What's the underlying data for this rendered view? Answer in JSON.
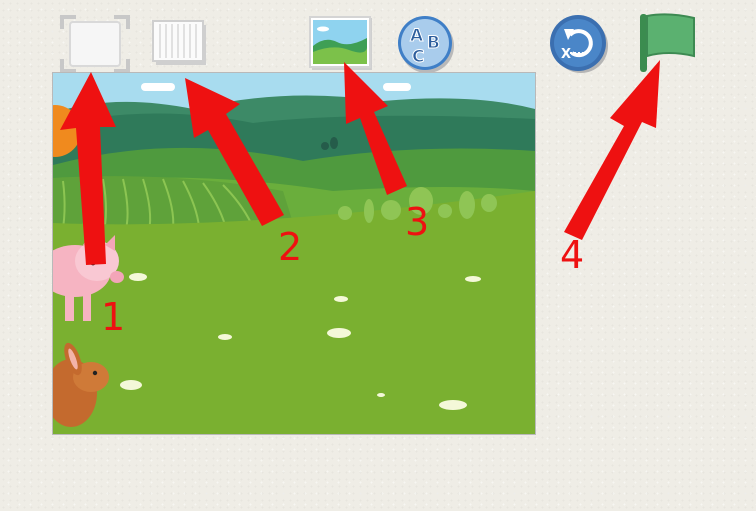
{
  "toolbar": {
    "tools": [
      {
        "name": "fullscreen",
        "icon": "fullscreen-icon"
      },
      {
        "name": "grid",
        "icon": "grid-icon"
      },
      {
        "name": "background",
        "icon": "landscape-image-icon"
      },
      {
        "name": "text",
        "icon": "abc-text-icon",
        "glyphs": [
          "A",
          "B",
          "C"
        ]
      },
      {
        "name": "reset",
        "icon": "reset-icon",
        "glyph": "X"
      },
      {
        "name": "green-flag",
        "icon": "green-flag-icon"
      }
    ]
  },
  "stage": {
    "scene": "farm field",
    "characters": [
      "pig",
      "rabbit"
    ]
  },
  "annotations": {
    "color": "#ee1111",
    "labels": [
      "1",
      "2",
      "3",
      "4"
    ]
  },
  "colors": {
    "accent_blue": "#3f7fc7",
    "flag_green": "#5bb170",
    "arrow_red": "#ee1111"
  }
}
